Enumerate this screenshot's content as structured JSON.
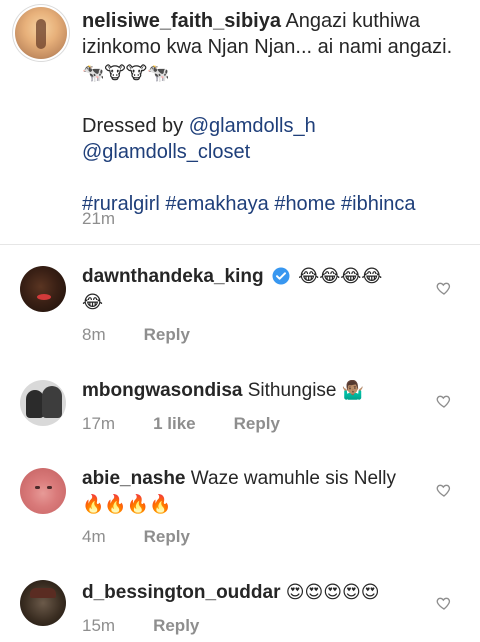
{
  "caption": {
    "username": "nelisiwe_faith_sibiya",
    "text_line1": " Angazi kuthiwa izinkomo kwa Njan Njan... ai nami angazi. ",
    "emojis": "🐄🐮🐮🐄",
    "dressed_by": "Dressed by ",
    "mention1": "@glamdolls_h",
    "mention2": "@glamdolls_closet",
    "hashtags": "#ruralgirl #emakhaya #home #ibhinca",
    "time": "21m"
  },
  "comments": [
    {
      "username": "dawnthandeka_king",
      "verified": true,
      "text": "",
      "emojis_line1": "😂😂😂😂",
      "emojis_line2": "😂",
      "time": "8m",
      "likes": "",
      "reply": "Reply"
    },
    {
      "username": "mbongwasondisa",
      "text": " Sithungise ",
      "emojis": "🤷🏽‍♂️",
      "time": "17m",
      "likes": "1 like",
      "reply": "Reply"
    },
    {
      "username": "abie_nashe",
      "text": " Waze wamuhle sis Nelly",
      "emojis_line2": "🔥🔥🔥🔥",
      "time": "4m",
      "likes": "",
      "reply": "Reply"
    },
    {
      "username": "d_bessington_ouddar",
      "text": " ",
      "emojis": "😍😍😍😍😍",
      "time": "15m",
      "likes": "",
      "reply": "Reply"
    }
  ],
  "colors": {
    "link": "#1f3f7a",
    "muted": "#8e8e8e",
    "verified": "#3897f0"
  },
  "icons": {
    "like": "heart-outline-icon",
    "verified": "verified-badge-icon"
  }
}
